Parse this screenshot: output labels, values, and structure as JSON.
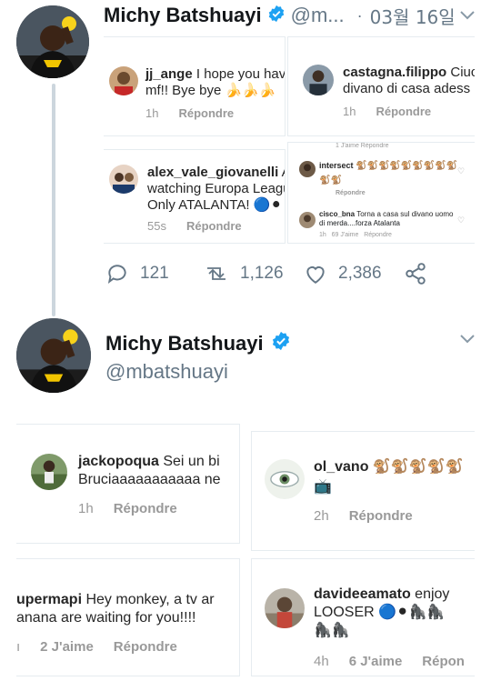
{
  "colors": {
    "link_blue": "#1da1f2",
    "verified": "#1da1f2",
    "gray_text": "#657786",
    "border": "#e6ecf0"
  },
  "tweet1": {
    "name": "Michy Batshuayi",
    "handle": "@m...",
    "sep": "·",
    "date": "03월 16일",
    "chevron_icon": "chevron-down-icon",
    "cards": {
      "c1": {
        "user": "jj_ange",
        "text1": "I hope you have",
        "text2": "mf!! Bye bye 🍌🍌🍌",
        "time": "1h",
        "reply": "Répondre"
      },
      "c2": {
        "user": "castagna.filippo",
        "text1": "Ciuc",
        "text2": "divano di casa adess",
        "time": "1h",
        "reply": "Répondre"
      },
      "c3": {
        "user": "alex_vale_giovanelli",
        "text1": "Ah",
        "text2": "watching Europa Leagu",
        "text3": "Only ATALANTA! 🔵⚫",
        "time": "55s",
        "reply": "Répondre"
      },
      "c4": {
        "top_meta": "1 J'aime   Répondre",
        "user1": "intersect",
        "text1": "🐒🐒🐒🐒🐒🐒🐒🐒🐒",
        "text1b": "🐒🐒",
        "reply1": "Répondre",
        "user2": "cisco_bna",
        "text2": "Torna a casa sul divano uomo",
        "text2b": "di merda....forza Atalanta",
        "meta2": "1h   69 J'aime   Répondre"
      }
    },
    "actions": {
      "replies": "121",
      "retweets": "1,126",
      "likes": "2,386"
    }
  },
  "tweet2": {
    "name": "Michy Batshuayi",
    "handle": "@mbatshuayi",
    "chevron_icon": "chevron-down-icon",
    "cards": {
      "c1": {
        "user": "jackopoqua",
        "text1": "Sei un bi",
        "text2": "Bruciaaaaaaaaaaa ne",
        "time": "1h",
        "reply": "Répondre"
      },
      "c2": {
        "user": "ol_vano",
        "text1": "🐒🐒🐒🐒🐒",
        "text2": "📺",
        "time": "2h",
        "reply": "Répondre"
      },
      "c3": {
        "user": "upermapi",
        "text1": "Hey monkey, a tv ar",
        "text2": "anana are waiting for you!!!!",
        "time": "ı",
        "likes": "2 J'aime",
        "reply": "Répondre"
      },
      "c4": {
        "user": "davideeamato",
        "text1": "enjoy",
        "text2": "LOOSER 🔵⚫🦍🦍",
        "text3": "🦍🦍",
        "time": "4h",
        "likes": "6 J'aime",
        "reply": "Répon"
      }
    }
  }
}
